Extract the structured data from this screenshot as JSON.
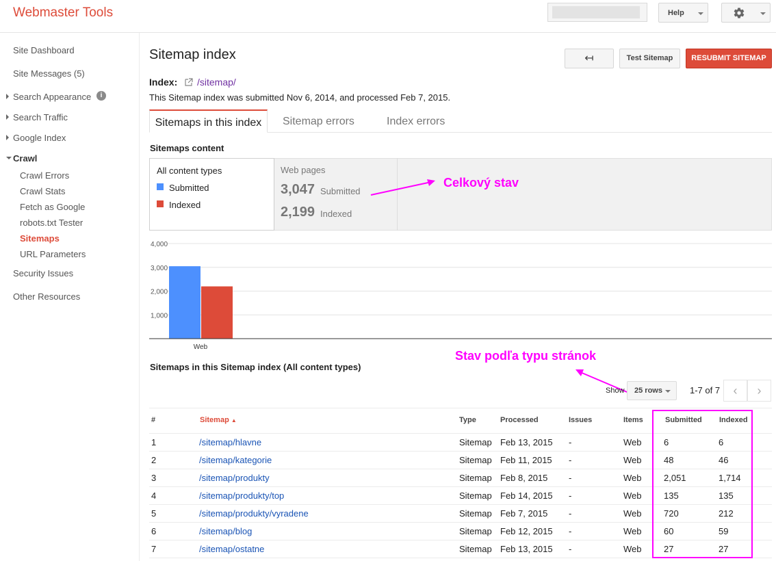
{
  "header": {
    "app_title": "Webmaster Tools",
    "help_label": "Help",
    "settings_icon": "gear-icon"
  },
  "sidebar": {
    "items": [
      {
        "label": "Site Dashboard"
      },
      {
        "label": "Site Messages (5)"
      },
      {
        "label": "Search Appearance"
      },
      {
        "label": "Search Traffic"
      },
      {
        "label": "Google Index"
      },
      {
        "label": "Crawl"
      },
      {
        "label": "Crawl Errors"
      },
      {
        "label": "Crawl Stats"
      },
      {
        "label": "Fetch as Google"
      },
      {
        "label": "robots.txt Tester"
      },
      {
        "label": "Sitemaps"
      },
      {
        "label": "URL Parameters"
      },
      {
        "label": "Security Issues"
      },
      {
        "label": "Other Resources"
      }
    ],
    "info_glyph": "i"
  },
  "main": {
    "title": "Sitemap index",
    "back_glyph": "↤",
    "test_label": "Test Sitemap",
    "resubmit_label": "RESUBMIT SITEMAP",
    "index_label": "Index:",
    "index_path": "/sitemap/",
    "submitted_text": "This Sitemap index was submitted Nov 6, 2014, and processed Feb 7, 2015.",
    "tabs": [
      {
        "label": "Sitemaps in this index"
      },
      {
        "label": "Sitemap errors"
      },
      {
        "label": "Index errors"
      }
    ],
    "content_title": "Sitemaps content",
    "content_types": {
      "selected": "All content types",
      "legend": [
        {
          "label": "Submitted",
          "color": "#4d90fe"
        },
        {
          "label": "Indexed",
          "color": "#dd4b39"
        }
      ]
    },
    "web_pages": {
      "label": "Web pages",
      "submitted_value": "3,047",
      "submitted_label": "Submitted",
      "indexed_value": "2,199",
      "indexed_label": "Indexed"
    },
    "annotation_total": "Celkový stav",
    "annotation_by_type": "Stav podľa typu stránok",
    "table_title": "Sitemaps in this Sitemap index (All content types)",
    "pager": {
      "show_label": "Show",
      "rows_label": "25 rows",
      "range": "1-7 of 7",
      "prev_glyph": "‹",
      "next_glyph": "›"
    },
    "table": {
      "headers": [
        "#",
        "Sitemap",
        "Type",
        "Processed",
        "Issues",
        "Items",
        "Submitted",
        "Indexed"
      ],
      "sort_glyph": "▲",
      "rows": [
        {
          "num": "1",
          "path": "/sitemap/hlavne",
          "type": "Sitemap",
          "processed": "Feb 13, 2015",
          "issues": "-",
          "items": "Web",
          "submitted": "6",
          "indexed": "6"
        },
        {
          "num": "2",
          "path": "/sitemap/kategorie",
          "type": "Sitemap",
          "processed": "Feb 11, 2015",
          "issues": "-",
          "items": "Web",
          "submitted": "48",
          "indexed": "46"
        },
        {
          "num": "3",
          "path": "/sitemap/produkty",
          "type": "Sitemap",
          "processed": "Feb 8, 2015",
          "issues": "-",
          "items": "Web",
          "submitted": "2,051",
          "indexed": "1,714"
        },
        {
          "num": "4",
          "path": "/sitemap/produkty/top",
          "type": "Sitemap",
          "processed": "Feb 14, 2015",
          "issues": "-",
          "items": "Web",
          "submitted": "135",
          "indexed": "135"
        },
        {
          "num": "5",
          "path": "/sitemap/produkty/vyradene",
          "type": "Sitemap",
          "processed": "Feb 7, 2015",
          "issues": "-",
          "items": "Web",
          "submitted": "720",
          "indexed": "212"
        },
        {
          "num": "6",
          "path": "/sitemap/blog",
          "type": "Sitemap",
          "processed": "Feb 12, 2015",
          "issues": "-",
          "items": "Web",
          "submitted": "60",
          "indexed": "59"
        },
        {
          "num": "7",
          "path": "/sitemap/ostatne",
          "type": "Sitemap",
          "processed": "Feb 13, 2015",
          "issues": "-",
          "items": "Web",
          "submitted": "27",
          "indexed": "27"
        }
      ]
    }
  },
  "chart_data": {
    "type": "bar",
    "categories": [
      "Web"
    ],
    "series": [
      {
        "name": "Submitted",
        "values": [
          3047
        ],
        "color": "#4d90fe"
      },
      {
        "name": "Indexed",
        "values": [
          2199
        ],
        "color": "#dd4b39"
      }
    ],
    "y_ticks": [
      "4,000",
      "3,000",
      "2,000",
      "1,000"
    ],
    "ylim": [
      0,
      4000
    ],
    "grid": true
  }
}
